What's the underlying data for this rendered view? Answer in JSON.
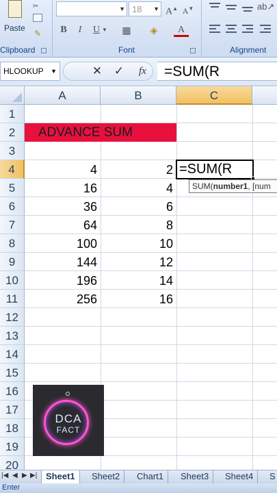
{
  "ribbon": {
    "clipboard": {
      "paste_label": "Paste",
      "group_label": "Clipboard"
    },
    "font": {
      "font_size": "18",
      "bold": "B",
      "italic": "I",
      "underline": "U",
      "grow_font": "A",
      "shrink_font": "A",
      "font_color_letter": "A",
      "group_label": "Font"
    },
    "alignment": {
      "group_label": "Alignment"
    }
  },
  "formula_bar": {
    "name_box": "HLOOKUP",
    "cancel": "✕",
    "enter": "✓",
    "fx": "fx",
    "formula": "=SUM(R"
  },
  "columns": [
    "A",
    "B",
    "C"
  ],
  "rows": [
    "1",
    "2",
    "3",
    "4",
    "5",
    "6",
    "7",
    "8",
    "9",
    "10",
    "11",
    "12",
    "13",
    "14",
    "15",
    "16",
    "17",
    "18",
    "19",
    "20"
  ],
  "cells": {
    "title": "ADVANCE SUM",
    "col_a": [
      "4",
      "16",
      "36",
      "64",
      "100",
      "144",
      "196",
      "256"
    ],
    "col_b": [
      "2",
      "4",
      "6",
      "8",
      "10",
      "12",
      "14",
      "16"
    ],
    "active_value": "=SUM(R"
  },
  "tooltip": {
    "prefix": "SUM(",
    "bold": "number1",
    "rest": ", [num"
  },
  "logo": {
    "top": "DCA",
    "bottom": "FACT"
  },
  "sheets": [
    "Sheet1",
    "Sheet2",
    "Chart1",
    "Sheet3",
    "Sheet4",
    "S"
  ],
  "status": "Enter",
  "colors": {
    "title_fill": "#e8113e",
    "selected_header": "#f1c15f"
  }
}
